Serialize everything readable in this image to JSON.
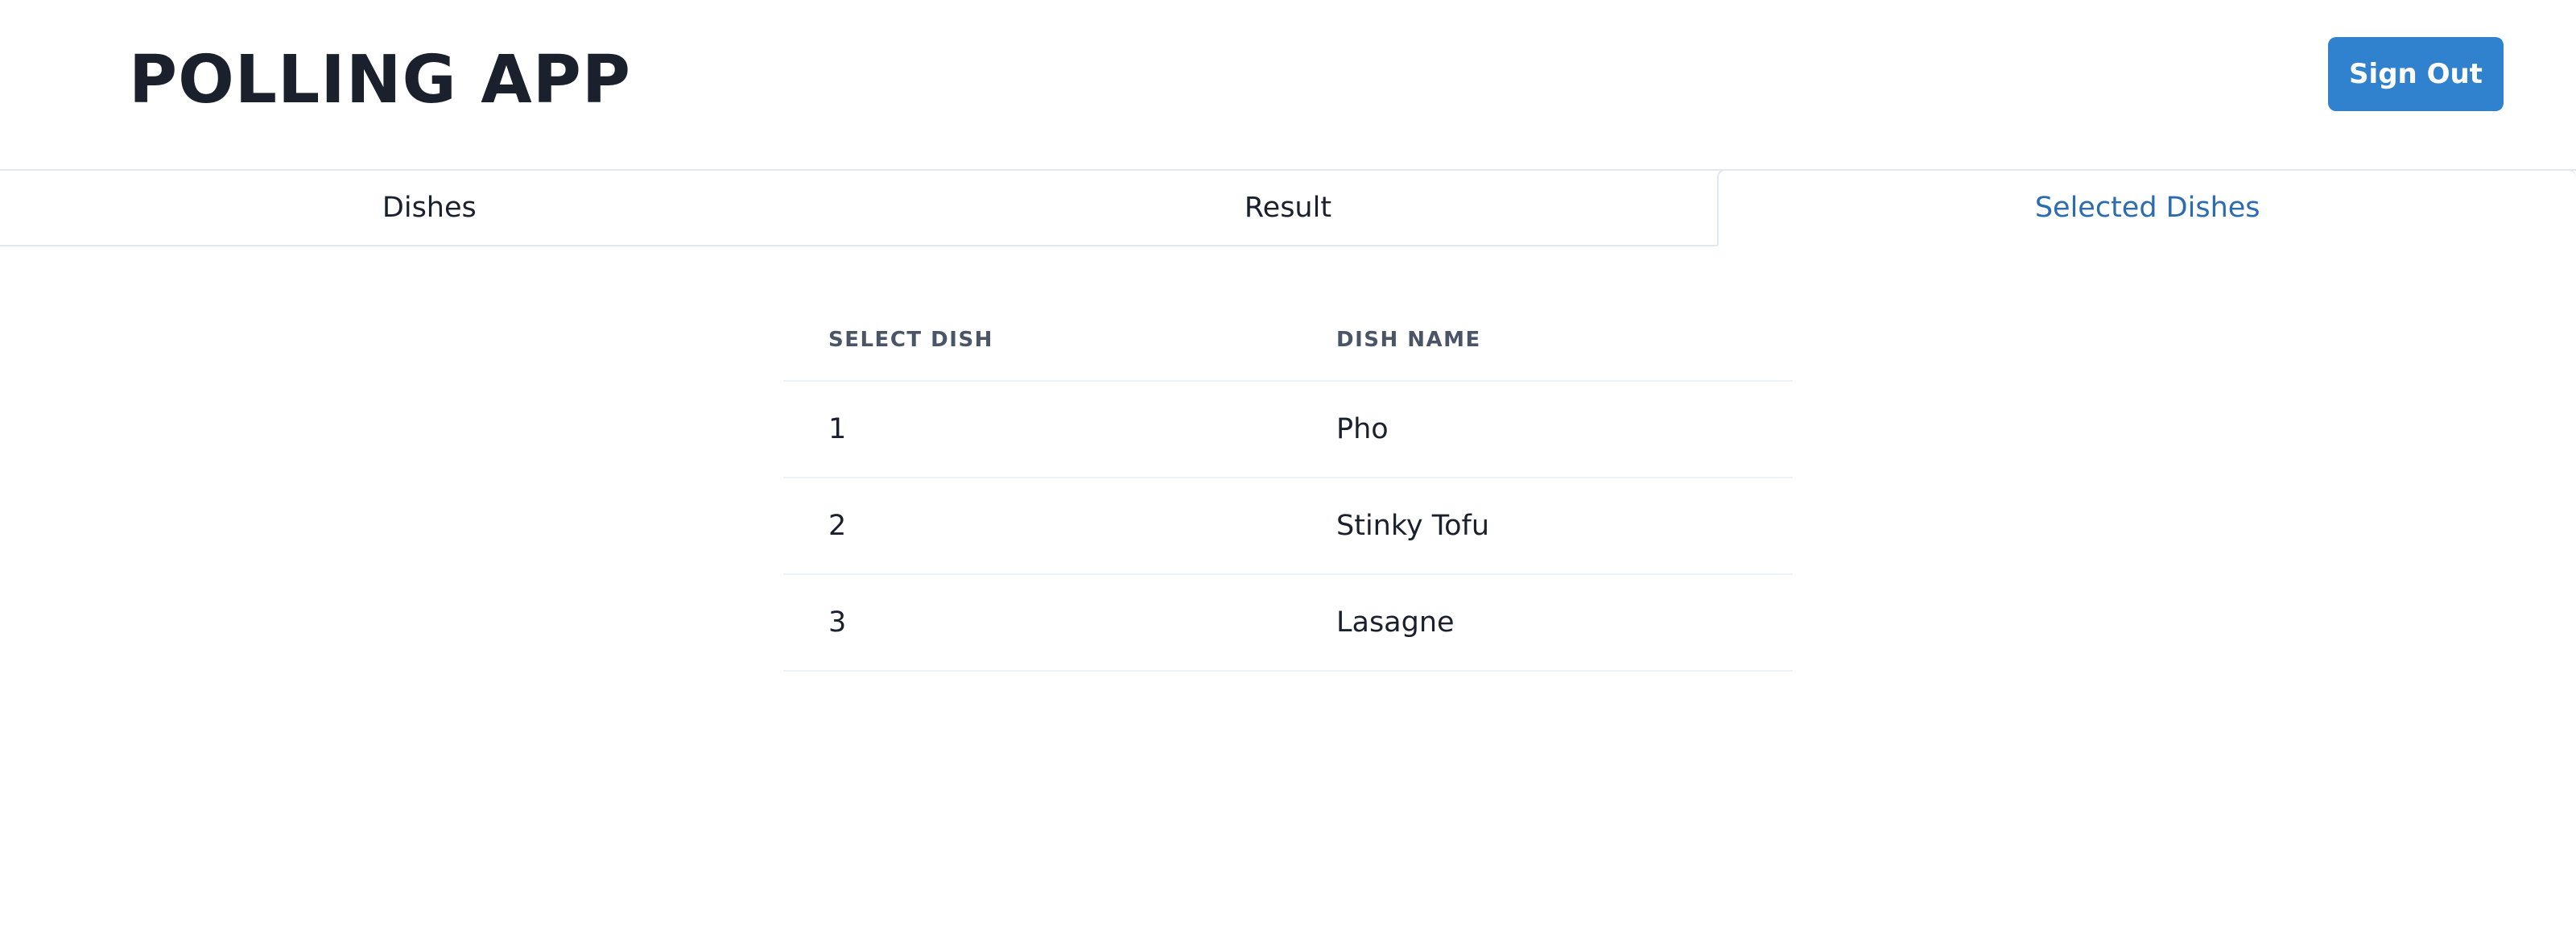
{
  "header": {
    "title": "POLLING APP",
    "sign_out_label": "Sign Out"
  },
  "tabs": [
    {
      "label": "Dishes",
      "active": false
    },
    {
      "label": "Result",
      "active": false
    },
    {
      "label": "Selected Dishes",
      "active": true
    }
  ],
  "table": {
    "columns": [
      "SELECT DISH",
      "DISH NAME"
    ],
    "rows": [
      {
        "select": "1",
        "name": "Pho"
      },
      {
        "select": "2",
        "name": "Stinky Tofu"
      },
      {
        "select": "3",
        "name": "Lasagne"
      }
    ]
  },
  "colors": {
    "accent": "#3182ce",
    "active_tab_text": "#2b6cb0",
    "title_text": "#1a202c",
    "header_text": "#4a5568",
    "divider": "#e2e8f0"
  }
}
